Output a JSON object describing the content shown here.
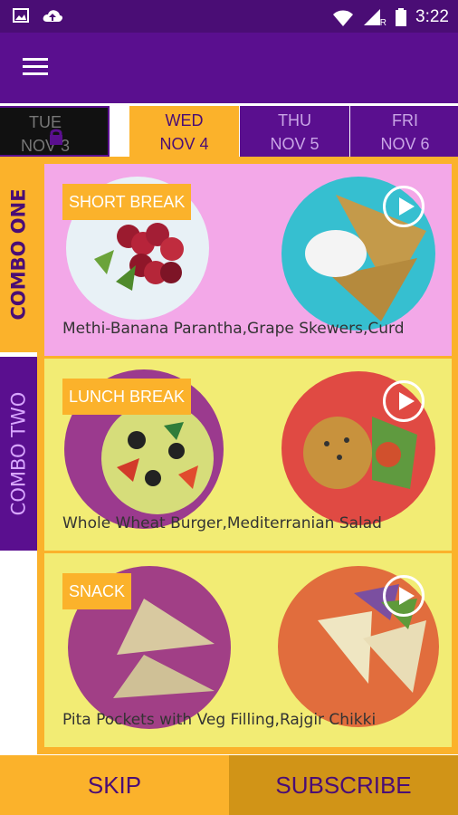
{
  "status": {
    "time": "3:22",
    "network_badge": "R",
    "left_icons": [
      "image-icon",
      "cloud-upload-icon"
    ],
    "right_icons": [
      "wifi-icon",
      "cell-signal-icon",
      "battery-icon"
    ]
  },
  "date_tabs": [
    {
      "day": "TUE",
      "date": "NOV 3",
      "state": "locked"
    },
    {
      "day": "WED",
      "date": "NOV 4",
      "state": "active"
    },
    {
      "day": "THU",
      "date": "NOV 5",
      "state": "normal"
    },
    {
      "day": "FRI",
      "date": "NOV 6",
      "state": "normal"
    }
  ],
  "combos": [
    {
      "label": "COMBO ONE",
      "state": "active"
    },
    {
      "label": "COMBO TWO",
      "state": "inactive"
    }
  ],
  "meals": [
    {
      "tag": "SHORT BREAK",
      "description": "Methi-Banana Parantha,Grape Skewers,Curd"
    },
    {
      "tag": "LUNCH BREAK",
      "description": "Whole Wheat Burger,Mediterranian Salad"
    },
    {
      "tag": "SNACK",
      "description": "Pita Pockets with Veg Filling,Rajgir Chikki"
    }
  ],
  "actions": {
    "skip": "SKIP",
    "subscribe": "SUBSCRIBE"
  },
  "colors": {
    "purple": "#5a0f8f",
    "orange": "#fbb22b",
    "pink": "#f3a8e8",
    "yellow": "#f2ec74"
  }
}
